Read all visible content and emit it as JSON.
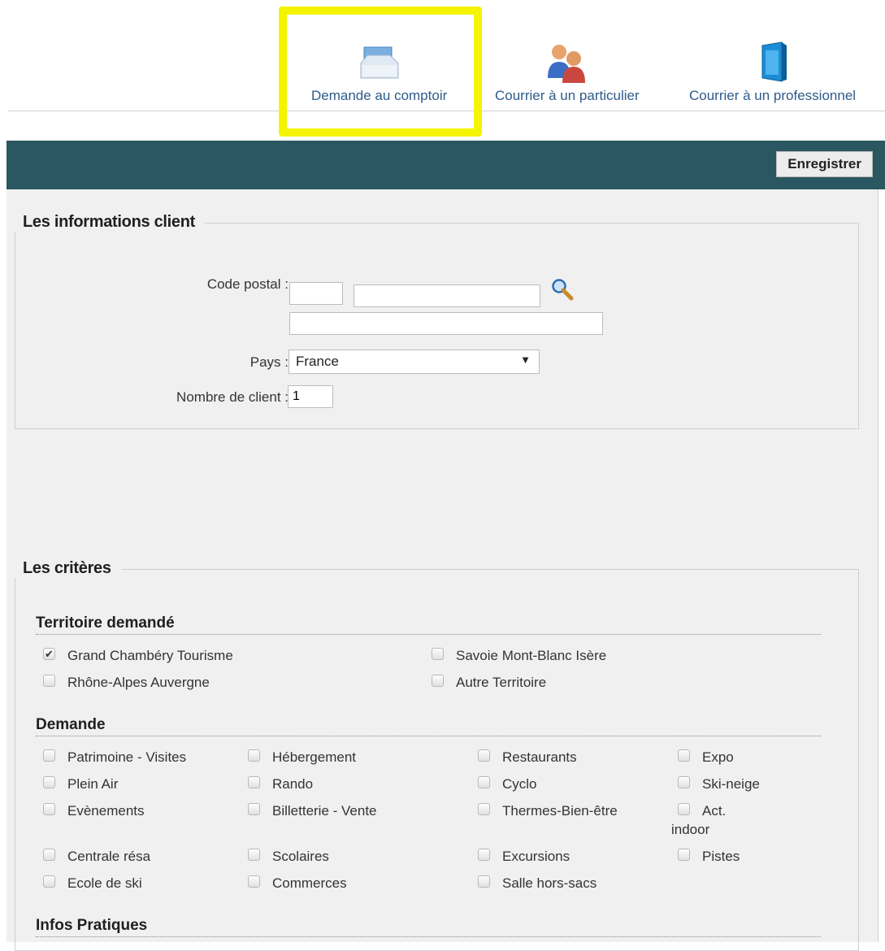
{
  "nav": {
    "items": [
      {
        "label": "Demande au comptoir",
        "icon": "inbox-tray-icon"
      },
      {
        "label": "Courrier à un particulier",
        "icon": "people-icon"
      },
      {
        "label": "Courrier à un professionnel",
        "icon": "building-icon"
      }
    ],
    "highlight_color": "#f4f400"
  },
  "toolbar": {
    "save_label": "Enregistrer",
    "bar_color": "#2a5761"
  },
  "client": {
    "legend": "Les informations client",
    "code_postal_label": "Code postal :",
    "code_postal_value": "",
    "ville_value": "",
    "adresse_value": "",
    "pays_label": "Pays :",
    "pays_value": "France",
    "nombre_label": "Nombre de client :",
    "nombre_value": "1"
  },
  "criteres": {
    "legend": "Les critères",
    "territoire": {
      "title": "Territoire demandé",
      "items": [
        {
          "label": "Grand Chambéry Tourisme",
          "checked": true
        },
        {
          "label": "Savoie Mont-Blanc Isère",
          "checked": false
        },
        {
          "label": "Rhône-Alpes Auvergne",
          "checked": false
        },
        {
          "label": "Autre Territoire",
          "checked": false
        }
      ]
    },
    "demande": {
      "title": "Demande",
      "items": [
        {
          "label": "Patrimoine - Visites",
          "checked": false
        },
        {
          "label": "Hébergement",
          "checked": false
        },
        {
          "label": "Restaurants",
          "checked": false
        },
        {
          "label": "Expo",
          "checked": false
        },
        {
          "label": "Plein Air",
          "checked": false
        },
        {
          "label": "Rando",
          "checked": false
        },
        {
          "label": "Cyclo",
          "checked": false
        },
        {
          "label": "Ski-neige",
          "checked": false
        },
        {
          "label": "Evènements",
          "checked": false
        },
        {
          "label": "Billetterie - Vente",
          "checked": false
        },
        {
          "label": "Thermes-Bien-être",
          "checked": false
        },
        {
          "label": "Act.",
          "label2": "indoor",
          "checked": false
        },
        {
          "label": "Centrale résa",
          "checked": false
        },
        {
          "label": "Scolaires",
          "checked": false
        },
        {
          "label": "Excursions",
          "checked": false
        },
        {
          "label": "Pistes",
          "checked": false
        },
        {
          "label": "Ecole de ski",
          "checked": false
        },
        {
          "label": "Commerces",
          "checked": false
        },
        {
          "label": "Salle hors-sacs",
          "checked": false
        }
      ]
    },
    "infos_title": "Infos Pratiques"
  }
}
